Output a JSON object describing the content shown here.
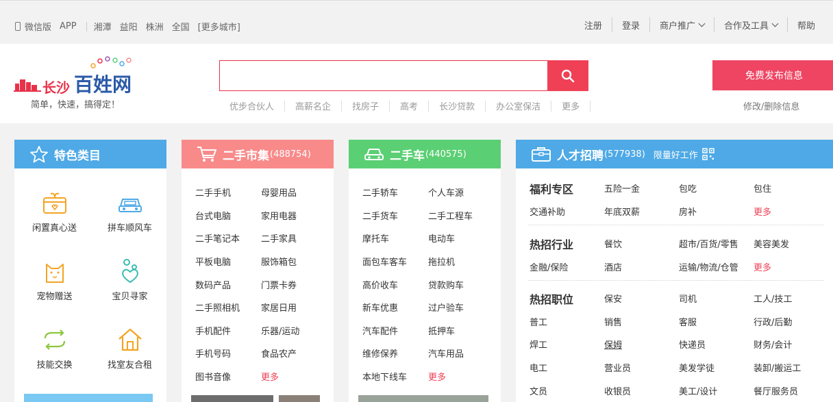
{
  "topbar": {
    "left_items": [
      "微信版",
      "APP"
    ],
    "cities": [
      "湘潭",
      "益阳",
      "株洲",
      "全国",
      "[更多城市]"
    ],
    "right_items": [
      {
        "label": "注册",
        "dropdown": false
      },
      {
        "label": "登录",
        "dropdown": false
      },
      {
        "label": "商户推广",
        "dropdown": true
      },
      {
        "label": "合作及工具",
        "dropdown": true
      },
      {
        "label": "帮助",
        "dropdown": false
      }
    ]
  },
  "header": {
    "logo_city": "长沙",
    "logo_brand": "百姓网",
    "slogan": "简单，快速，搞得定！",
    "search_value": "",
    "hot_words": [
      "优步合伙人",
      "高薪名企",
      "找房子",
      "高考",
      "长沙贷款",
      "办公室保洁",
      "更多"
    ],
    "publish_label": "免费发布信息",
    "edit_label": "修改/删除信息"
  },
  "featured": {
    "title": "特色类目",
    "items": [
      {
        "label": "闲置真心送",
        "icon": "gift-icon"
      },
      {
        "label": "拼车顺风车",
        "icon": "car-icon"
      },
      {
        "label": "宠物赠送",
        "icon": "cat-icon"
      },
      {
        "label": "宝贝寻家",
        "icon": "heart-person-icon"
      },
      {
        "label": "技能交换",
        "icon": "swap-icon"
      },
      {
        "label": "找室友合租",
        "icon": "home-icon"
      }
    ]
  },
  "secondhand": {
    "title": "二手市集",
    "count": "(488754)",
    "col1": [
      "二手手机",
      "台式电脑",
      "二手笔记本",
      "平板电脑",
      "数码产品",
      "二手照相机",
      "手机配件",
      "手机号码",
      "图书音像"
    ],
    "col2": [
      "母婴用品",
      "家用电器",
      "二手家具",
      "服饰箱包",
      "门票卡券",
      "家居日用",
      "乐器/运动",
      "食品农产",
      "更多"
    ]
  },
  "usedcar": {
    "title": "二手车",
    "count": "(440575)",
    "col1": [
      "二手轿车",
      "二手货车",
      "摩托车",
      "面包车客车",
      "高价收车",
      "新车优惠",
      "汽车配件",
      "维修保养",
      "本地下线车"
    ],
    "col2": [
      "个人车源",
      "二手工程车",
      "电动车",
      "拖拉机",
      "贷款购车",
      "过户验车",
      "抵押车",
      "汽车用品",
      "更多"
    ]
  },
  "jobs": {
    "title": "人才招聘",
    "count": "(577938)",
    "sub_label": "限量好工作",
    "groups": [
      {
        "heading": "福利专区",
        "items": [
          "五险一金",
          "包吃",
          "包住",
          "交通补助",
          "年底双薪",
          "房补",
          "更多"
        ]
      },
      {
        "heading": "热招行业",
        "items": [
          "餐饮",
          "超市/百货/零售",
          "美容美发",
          "金融/保险",
          "酒店",
          "运输/物流/仓管",
          "更多"
        ]
      },
      {
        "heading": "热招职位",
        "items": [
          "保安",
          "司机",
          "工人/技工",
          "普工",
          "销售",
          "客服",
          "行政/后勤",
          "焊工",
          "保姆",
          "快递员",
          "财务/会计",
          "电工",
          "营业员",
          "美发学徒",
          "装卸/搬运工",
          "文员",
          "收银员",
          "美工/设计",
          "餐厅服务员"
        ]
      }
    ]
  },
  "colors": {
    "accent_red": "#ef4056",
    "blue": "#4ea9e6",
    "pink": "#f98a8a",
    "green": "#5bcf74",
    "brand_blue": "#2b5aa8"
  }
}
